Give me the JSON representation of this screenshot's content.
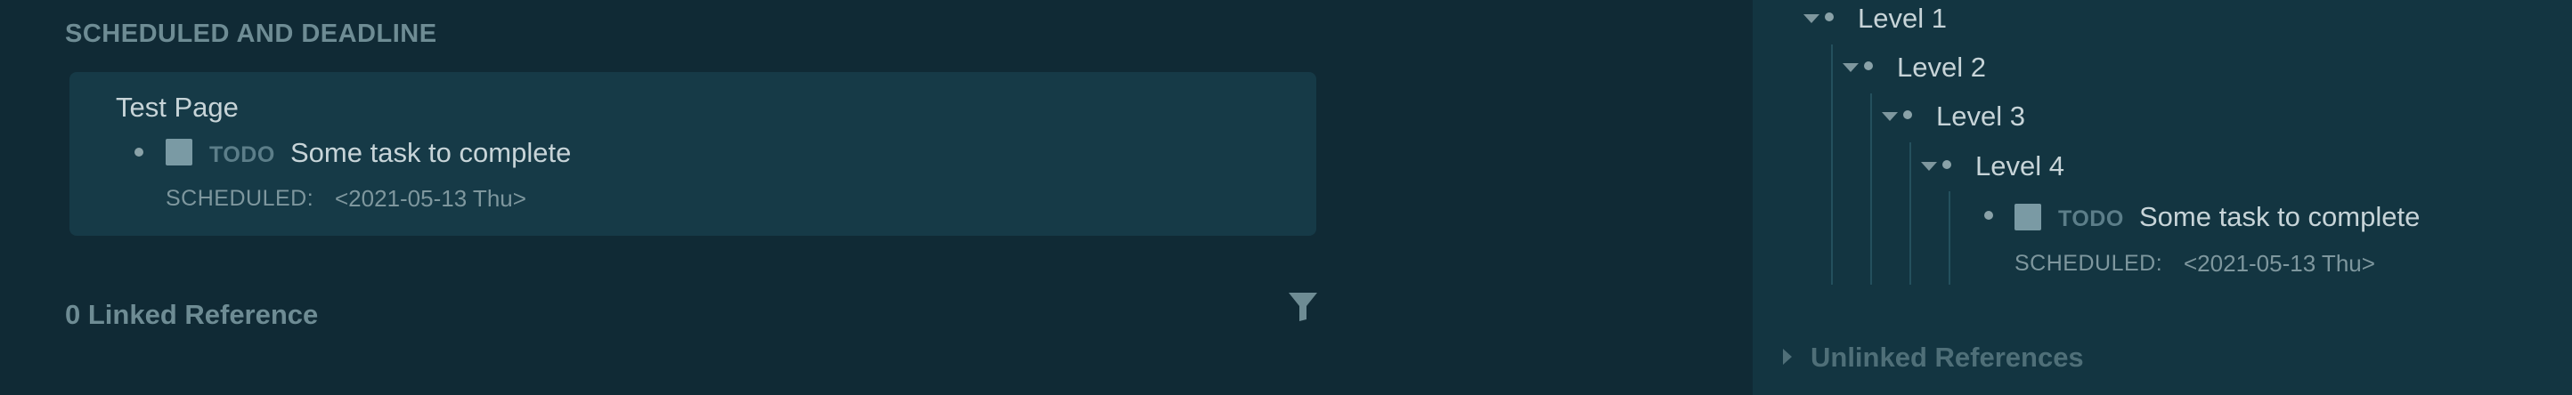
{
  "left_panel": {
    "section_title": "SCHEDULED AND DEADLINE",
    "card": {
      "page_title": "Test Page",
      "task": {
        "marker": "TODO",
        "text": "Some task to complete",
        "scheduled_label": "SCHEDULED:",
        "scheduled_date": "<2021-05-13 Thu>"
      }
    },
    "linked_references": "0 Linked Reference",
    "filter_icon": "filter-icon"
  },
  "right_panel": {
    "levels": [
      "Level 1",
      "Level 2",
      "Level 3",
      "Level 4"
    ],
    "task": {
      "marker": "TODO",
      "text": "Some task to complete",
      "scheduled_label": "SCHEDULED:",
      "scheduled_date": "<2021-05-13 Thu>"
    },
    "unlinked_references": "Unlinked References"
  },
  "colors": {
    "background": "#102a35",
    "sidebar_background": "#133541",
    "card_background": "#163a47",
    "text": "#c7d4d8",
    "muted": "#6e8c94",
    "checkbox": "#7a9aa4"
  }
}
